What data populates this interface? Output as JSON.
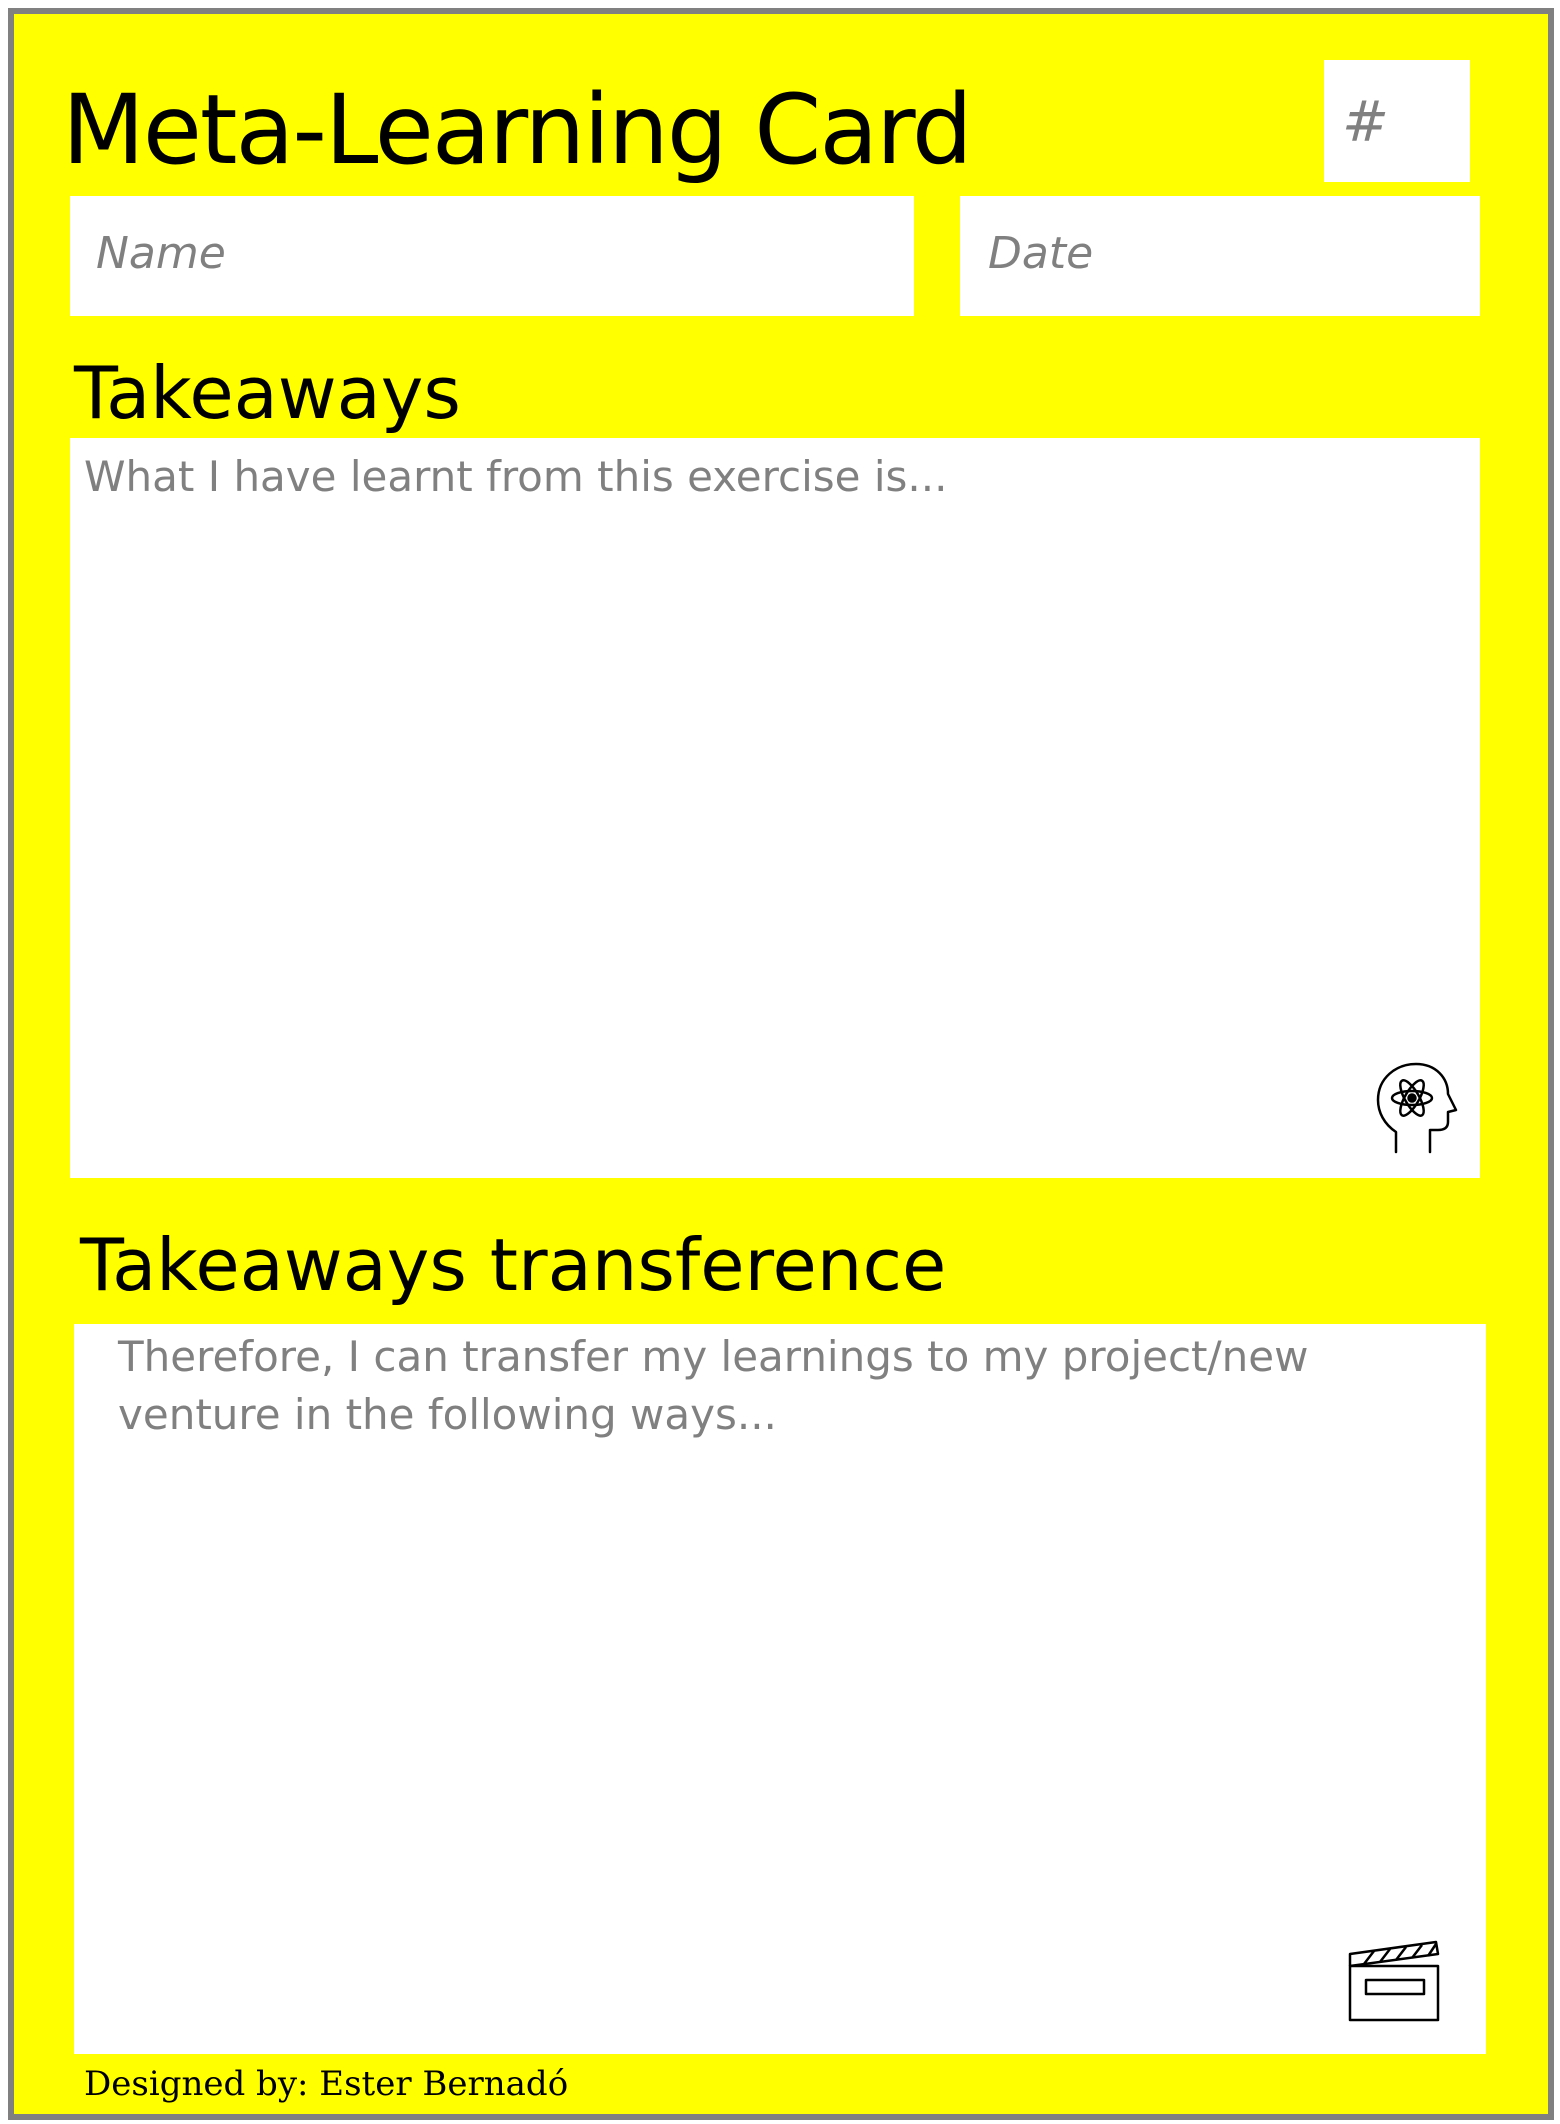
{
  "card": {
    "title": "Meta-Learning Card",
    "number_placeholder": "#",
    "name_placeholder": "Name",
    "date_placeholder": "Date"
  },
  "takeaways": {
    "heading": "Takeaways",
    "prompt": "What I have learnt from this exercise is...",
    "icon": "head-atom-icon"
  },
  "transference": {
    "heading": "Takeaways transference",
    "prompt": "Therefore, I can transfer my learnings to my project/new venture in the following ways...",
    "icon": "clapperboard-icon"
  },
  "footer": {
    "credit": "Designed by: Ester Bernadó"
  },
  "colors": {
    "card_background": "#ffff00",
    "border": "#808080",
    "placeholder_text": "#808080"
  }
}
